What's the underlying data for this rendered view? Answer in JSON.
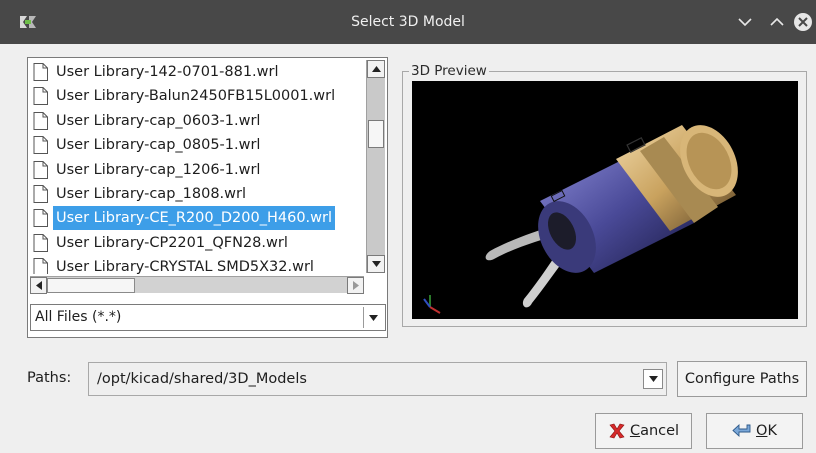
{
  "window": {
    "title": "Select 3D Model",
    "colors": {
      "titlebar": "#484848",
      "selection": "#3d9ee8",
      "background": "#efefef"
    }
  },
  "file_list": {
    "items": [
      {
        "label": "User Library-142-0701-881.wrl",
        "selected": false
      },
      {
        "label": "User Library-Balun2450FB15L0001.wrl",
        "selected": false
      },
      {
        "label": "User Library-cap_0603-1.wrl",
        "selected": false
      },
      {
        "label": "User Library-cap_0805-1.wrl",
        "selected": false
      },
      {
        "label": "User Library-cap_1206-1.wrl",
        "selected": false
      },
      {
        "label": "User Library-cap_1808.wrl",
        "selected": false
      },
      {
        "label": "User Library-CE_R200_D200_H460.wrl",
        "selected": true
      },
      {
        "label": "User Library-CP2201_QFN28.wrl",
        "selected": false
      },
      {
        "label": "User Library-CRYSTAL SMD5X32.wrl",
        "selected": false
      }
    ],
    "filter": "All Files (*.*)"
  },
  "preview": {
    "title": "3D Preview"
  },
  "paths": {
    "label": "Paths:",
    "value": "/opt/kicad/shared/3D_Models"
  },
  "buttons": {
    "configure": "Configure Paths",
    "cancel_first": "C",
    "cancel_rest": "ancel",
    "ok_first": "O",
    "ok_rest": "K"
  }
}
